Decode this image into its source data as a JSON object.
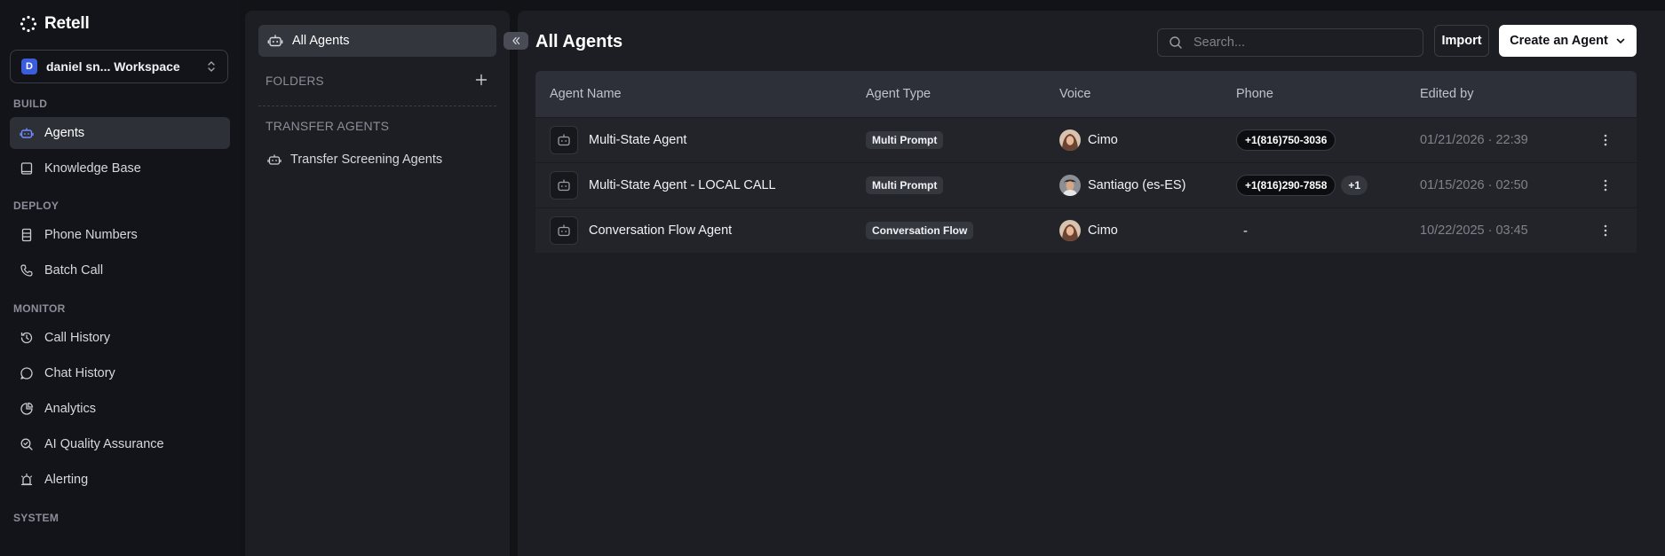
{
  "brand": {
    "name": "Retell"
  },
  "workspace": {
    "badge": "D",
    "name": "daniel sn... Workspace"
  },
  "nav": {
    "sections": [
      {
        "label": "BUILD",
        "items": [
          {
            "label": "Agents",
            "icon": "robot-icon",
            "active": true
          },
          {
            "label": "Knowledge Base",
            "icon": "book-icon",
            "active": false
          }
        ]
      },
      {
        "label": "DEPLOY",
        "items": [
          {
            "label": "Phone Numbers",
            "icon": "phone-book-icon",
            "active": false
          },
          {
            "label": "Batch Call",
            "icon": "phone-icon",
            "active": false
          }
        ]
      },
      {
        "label": "MONITOR",
        "items": [
          {
            "label": "Call History",
            "icon": "history-icon",
            "active": false
          },
          {
            "label": "Chat History",
            "icon": "chat-icon",
            "active": false
          },
          {
            "label": "Analytics",
            "icon": "pie-chart-icon",
            "active": false
          },
          {
            "label": "AI Quality Assurance",
            "icon": "search-check-icon",
            "active": false
          },
          {
            "label": "Alerting",
            "icon": "alarm-icon",
            "active": false
          }
        ]
      },
      {
        "label": "SYSTEM",
        "items": []
      }
    ]
  },
  "folders": {
    "all_agents_label": "All Agents",
    "folders_label": "FOLDERS",
    "transfer_label": "TRANSFER AGENTS",
    "transfer_item": "Transfer Screening Agents"
  },
  "main": {
    "title": "All Agents",
    "search_placeholder": "Search...",
    "import_label": "Import",
    "create_label": "Create an Agent",
    "columns": [
      "Agent Name",
      "Agent Type",
      "Voice",
      "Phone",
      "Edited by"
    ],
    "rows": [
      {
        "name": "Multi-State Agent",
        "type": "Multi Prompt",
        "voice": "Cimo",
        "voice_avatar": "female",
        "phone": "+1(816)750-3036",
        "extra": "",
        "edited": "01/21/2026 · 22:39"
      },
      {
        "name": "Multi-State Agent - LOCAL CALL",
        "type": "Multi Prompt",
        "voice": "Santiago (es-ES)",
        "voice_avatar": "male",
        "phone": "+1(816)290-7858",
        "extra": "+1",
        "edited": "01/15/2026 · 02:50"
      },
      {
        "name": "Conversation Flow Agent",
        "type": "Conversation Flow",
        "voice": "Cimo",
        "voice_avatar": "female",
        "phone": "-",
        "extra": "",
        "edited": "10/22/2025 · 03:45"
      }
    ]
  },
  "colors": {
    "accent": "#3b5ddb",
    "active_nav_bg": "#2e3038",
    "active_icon": "#6f8cff"
  }
}
